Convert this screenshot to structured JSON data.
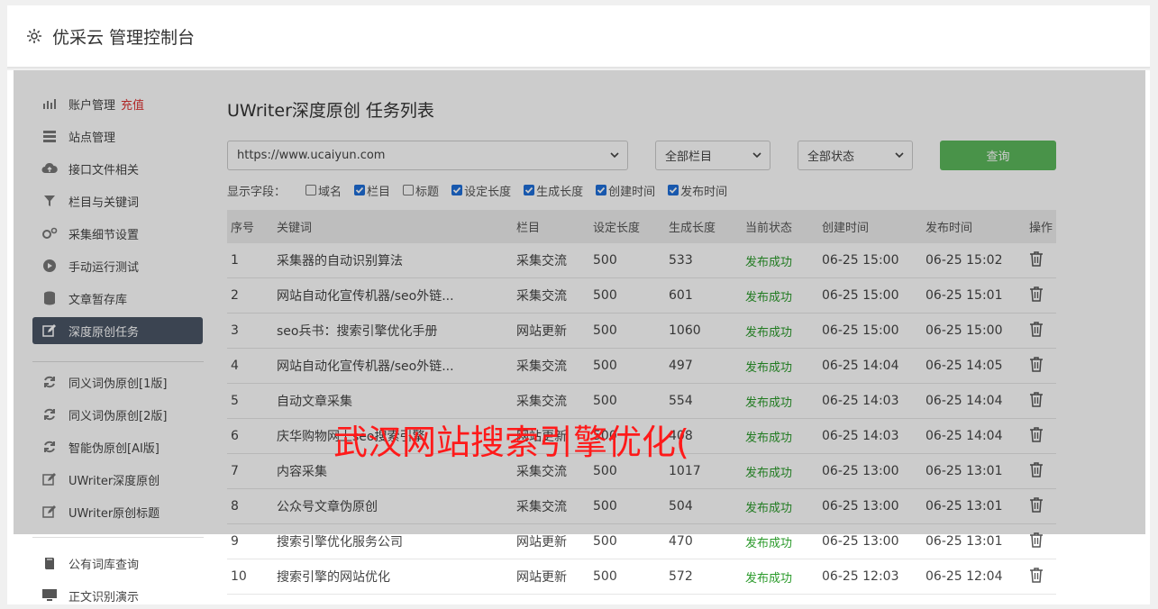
{
  "header": {
    "title": "优采云 管理控制台"
  },
  "sidebar": {
    "group1": [
      {
        "label": "账户管理",
        "extra": "充值",
        "icon": "bar-chart-icon"
      },
      {
        "label": "站点管理",
        "icon": "server-icon"
      },
      {
        "label": "接口文件相关",
        "icon": "cloud-upload-icon"
      },
      {
        "label": "栏目与关键词",
        "icon": "filter-icon"
      },
      {
        "label": "采集细节设置",
        "icon": "cogs-icon"
      },
      {
        "label": "手动运行测试",
        "icon": "play-icon"
      },
      {
        "label": "文章暂存库",
        "icon": "database-icon"
      },
      {
        "label": "深度原创任务",
        "icon": "edit-icon"
      }
    ],
    "group2": [
      {
        "label": "同义词伪原创[1版]",
        "icon": "refresh-icon"
      },
      {
        "label": "同义词伪原创[2版]",
        "icon": "refresh-icon"
      },
      {
        "label": "智能伪原创[AI版]",
        "icon": "refresh-icon"
      },
      {
        "label": "UWriter深度原创",
        "icon": "edit-icon"
      },
      {
        "label": "UWriter原创标题",
        "icon": "edit-icon"
      }
    ],
    "group3": [
      {
        "label": "公有词库查询",
        "icon": "book-icon"
      },
      {
        "label": "正文识别演示",
        "icon": "monitor-icon"
      }
    ]
  },
  "main": {
    "title": "UWriter深度原创 任务列表",
    "filters": {
      "site": "https://www.ucaiyun.com",
      "column": "全部栏目",
      "status": "全部状态",
      "query_label": "查询"
    },
    "fields_label": "显示字段：",
    "fields": [
      {
        "label": "域名",
        "checked": false
      },
      {
        "label": "栏目",
        "checked": true
      },
      {
        "label": "标题",
        "checked": false
      },
      {
        "label": "设定长度",
        "checked": true
      },
      {
        "label": "生成长度",
        "checked": true
      },
      {
        "label": "创建时间",
        "checked": true
      },
      {
        "label": "发布时间",
        "checked": true
      }
    ],
    "table": {
      "headers": [
        "序号",
        "关键词",
        "栏目",
        "设定长度",
        "生成长度",
        "当前状态",
        "创建时间",
        "发布时间",
        "操作"
      ],
      "rows": [
        [
          "1",
          "采集器的自动识别算法",
          "采集交流",
          "500",
          "533",
          "发布成功",
          "06-25 15:00",
          "06-25 15:02"
        ],
        [
          "2",
          "网站自动化宣传机器/seo外链...",
          "采集交流",
          "500",
          "601",
          "发布成功",
          "06-25 15:00",
          "06-25 15:01"
        ],
        [
          "3",
          "seo兵书：搜索引擎优化手册",
          "网站更新",
          "500",
          "1060",
          "发布成功",
          "06-25 15:00",
          "06-25 15:00"
        ],
        [
          "4",
          "网站自动化宣传机器/seo外链...",
          "采集交流",
          "500",
          "497",
          "发布成功",
          "06-25 14:04",
          "06-25 14:05"
        ],
        [
          "5",
          "自动文章采集",
          "采集交流",
          "500",
          "554",
          "发布成功",
          "06-25 14:03",
          "06-25 14:04"
        ],
        [
          "6",
          "庆华购物网上seo搜索引擎",
          "网站更新",
          "500",
          "408",
          "发布成功",
          "06-25 14:03",
          "06-25 14:04"
        ],
        [
          "7",
          "内容采集",
          "采集交流",
          "500",
          "1017",
          "发布成功",
          "06-25 13:00",
          "06-25 13:01"
        ],
        [
          "8",
          "公众号文章伪原创",
          "采集交流",
          "500",
          "504",
          "发布成功",
          "06-25 13:00",
          "06-25 13:01"
        ],
        [
          "9",
          "搜索引擎优化服务公司",
          "网站更新",
          "500",
          "470",
          "发布成功",
          "06-25 13:00",
          "06-25 13:01"
        ],
        [
          "10",
          "搜索引擎的网站优化",
          "网站更新",
          "500",
          "572",
          "发布成功",
          "06-25 12:03",
          "06-25 12:04"
        ]
      ]
    }
  },
  "watermark": "武汉网站搜索引擎优化(",
  "colors": {
    "active_nav": "#4a5566",
    "query_button": "#5cb85c",
    "status_ok": "#2a9a2a",
    "watermark": "#ff1a1a"
  }
}
